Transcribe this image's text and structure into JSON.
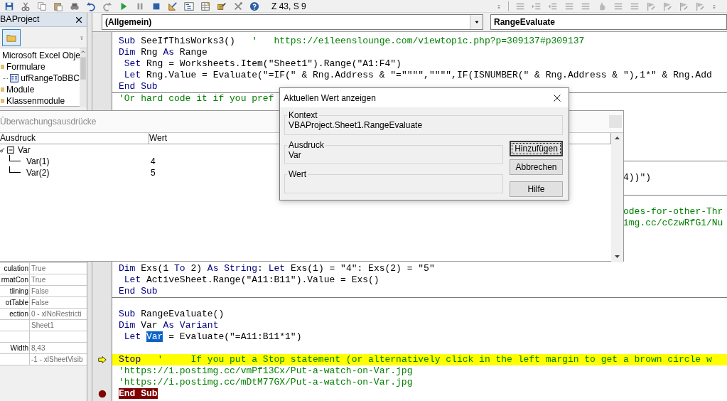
{
  "toolbar": {
    "cursor_position": "Z 43, S 9"
  },
  "project_explorer": {
    "title": "BAProject",
    "items": [
      {
        "label": "Microsoft Excel Obje",
        "kind": "folder"
      },
      {
        "label": "Formulare",
        "kind": "folder",
        "children": [
          {
            "label": "ufRangeToBBC",
            "kind": "form"
          }
        ]
      },
      {
        "label": "Module",
        "kind": "folder"
      },
      {
        "label": "Klassenmodule",
        "kind": "folder"
      }
    ]
  },
  "properties": {
    "rows": [
      {
        "name": "culation",
        "value": "True"
      },
      {
        "name": "rmatCon",
        "value": "True"
      },
      {
        "name": "tlining",
        "value": "False"
      },
      {
        "name": "otTable",
        "value": "False"
      },
      {
        "name": "ection",
        "value": "0 - xlNoRestricti"
      },
      {
        "value": "Sheet1"
      },
      {},
      {
        "name": "Width",
        "value": "8,43"
      },
      {
        "value": "-1 - xlSheetVisib"
      }
    ]
  },
  "code": {
    "object_box": "(Allgemein)",
    "procedure_box": "RangeEvaluate",
    "lines": [
      {
        "kind": "code",
        "segments": [
          {
            "text": "Sub",
            "kind": "keyword"
          },
          {
            "text": " SeeIfThisWorks3()   ",
            "kind": "plain"
          },
          {
            "text": "'   https://eileenslounge.com/viewtopic.php?p=309137#p309137",
            "kind": "comment"
          }
        ]
      },
      {
        "kind": "code",
        "segments": [
          {
            "text": "Dim",
            "kind": "keyword"
          },
          {
            "text": " Rng ",
            "kind": "plain"
          },
          {
            "text": "As",
            "kind": "keyword"
          },
          {
            "text": " Range",
            "kind": "plain"
          }
        ]
      },
      {
        "kind": "code",
        "segments": [
          {
            "text": " Set",
            "kind": "keyword"
          },
          {
            "text": " Rng = Worksheets.Item(\"Sheet1\").Range(\"A1:F4\")",
            "kind": "plain"
          }
        ]
      },
      {
        "kind": "code",
        "segments": [
          {
            "text": " Let",
            "kind": "keyword"
          },
          {
            "text": " Rng.Value = Evaluate(\"=IF(\" & Rng.Address & \"=\"\"\"\",\"\"\"\",IF(ISNUMBER(\" & Rng.Address & \"),1*\" & Rng.Add",
            "kind": "plain"
          }
        ]
      },
      {
        "kind": "code",
        "segments": [
          {
            "text": "End Sub",
            "kind": "keyword"
          }
        ]
      },
      {
        "kind": "code",
        "separator_above": true,
        "segments": [
          {
            "text": "'Or hard code it if you pref",
            "kind": "comment"
          }
        ]
      },
      {
        "kind": "blank"
      },
      {
        "kind": "blank"
      },
      {
        "kind": "blank"
      },
      {
        "kind": "blank"
      },
      {
        "kind": "blank"
      },
      {
        "kind": "blank",
        "separator_above": true
      },
      {
        "kind": "tail",
        "segments": [
          {
            "text": "4))\")",
            "kind": "plain"
          }
        ]
      },
      {
        "kind": "blank"
      },
      {
        "kind": "blank",
        "separator_above": true
      },
      {
        "kind": "tail",
        "segments": [
          {
            "text": "odes-for-other-Thr",
            "kind": "comment"
          }
        ]
      },
      {
        "kind": "tail",
        "segments": [
          {
            "text": "img.cc/cCzwRfG1/Nu",
            "kind": "comment"
          }
        ]
      },
      {
        "kind": "blank"
      },
      {
        "kind": "blank"
      },
      {
        "kind": "blank"
      },
      {
        "kind": "code",
        "segments": [
          {
            "text": "Dim",
            "kind": "keyword"
          },
          {
            "text": " Exs(1 ",
            "kind": "plain"
          },
          {
            "text": "To",
            "kind": "keyword"
          },
          {
            "text": " 2) ",
            "kind": "plain"
          },
          {
            "text": "As String",
            "kind": "keyword"
          },
          {
            "text": ": ",
            "kind": "plain"
          },
          {
            "text": "Let",
            "kind": "keyword"
          },
          {
            "text": " Exs(1) = \"4\": Exs(2) = \"5\"",
            "kind": "plain"
          }
        ]
      },
      {
        "kind": "code",
        "segments": [
          {
            "text": " Let",
            "kind": "keyword"
          },
          {
            "text": " ActiveSheet.Range(\"A11:B11\").Value = Exs()",
            "kind": "plain"
          }
        ]
      },
      {
        "kind": "code",
        "segments": [
          {
            "text": "End Sub",
            "kind": "keyword"
          }
        ]
      },
      {
        "kind": "blank",
        "separator_above": true
      },
      {
        "kind": "code",
        "segments": [
          {
            "text": "Sub",
            "kind": "keyword"
          },
          {
            "text": " RangeEvaluate()",
            "kind": "plain"
          }
        ]
      },
      {
        "kind": "code",
        "segments": [
          {
            "text": "Dim",
            "kind": "keyword"
          },
          {
            "text": " Var ",
            "kind": "plain"
          },
          {
            "text": "As Variant",
            "kind": "keyword"
          }
        ]
      },
      {
        "kind": "code",
        "segments": [
          {
            "text": " Let ",
            "kind": "keyword"
          },
          {
            "text": "Var",
            "kind": "selected"
          },
          {
            "text": " = Evaluate(\"=A11:B11*1\")",
            "kind": "plain"
          }
        ]
      },
      {
        "kind": "blank"
      },
      {
        "kind": "code",
        "current": true,
        "segments": [
          {
            "text": "Stop",
            "kind": "keyword"
          },
          {
            "text": "   '     If you put a Stop statement (or alternatively click in the left margin to get a brown circle w",
            "kind": "comment"
          }
        ]
      },
      {
        "kind": "code",
        "segments": [
          {
            "text": "'https://i.postimg.cc/vmPf13Cx/Put-a-watch-on-Var.jpg",
            "kind": "comment"
          }
        ]
      },
      {
        "kind": "code",
        "segments": [
          {
            "text": "'https://i.postimg.cc/mDtM77GX/Put-a-watch-on-Var.jpg",
            "kind": "comment"
          }
        ]
      },
      {
        "kind": "code",
        "breakpoint": true,
        "segments": [
          {
            "text": "End Sub",
            "kind": "keyword"
          }
        ]
      }
    ]
  },
  "watch_window": {
    "title": "Überwachungsausdrücke",
    "columns": [
      "Ausdruck",
      "Wert"
    ],
    "rows": [
      {
        "expression": "Var",
        "expanded": true,
        "children": [
          {
            "expression": "Var(1)",
            "value": "4"
          },
          {
            "expression": "Var(2)",
            "value": "5"
          }
        ]
      }
    ]
  },
  "dialog": {
    "title": "Aktuellen Wert anzeigen",
    "groups": [
      {
        "label": "Kontext",
        "value": "VBAProject.Sheet1.RangeEvaluate"
      },
      {
        "label": "Ausdruck",
        "value": "Var"
      },
      {
        "label": "Wert"
      }
    ],
    "buttons": [
      {
        "label": "Hinzufügen",
        "focused": true
      },
      {
        "label": "Abbrechen",
        "focused": false
      },
      {
        "label": "Hilfe",
        "focused": false
      }
    ]
  }
}
